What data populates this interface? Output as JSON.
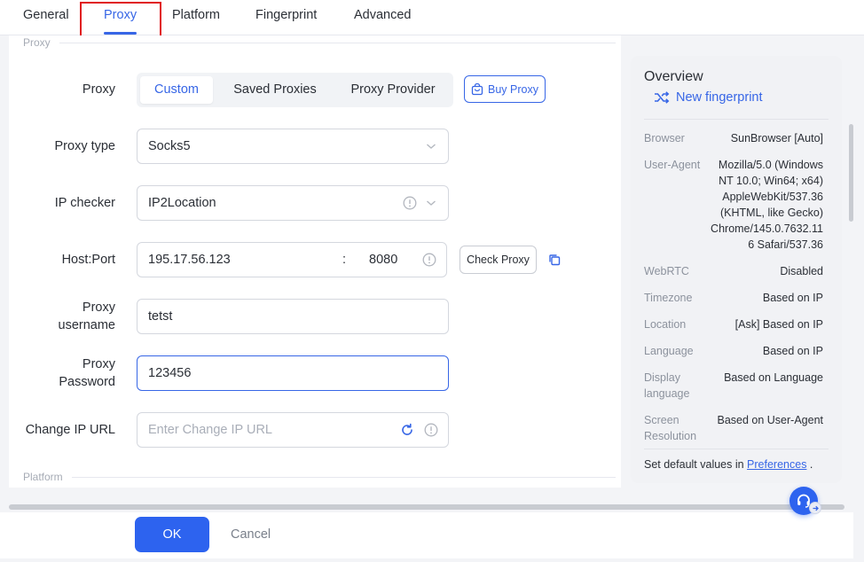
{
  "tabs": [
    {
      "label": "General"
    },
    {
      "label": "Proxy"
    },
    {
      "label": "Platform"
    },
    {
      "label": "Fingerprint"
    },
    {
      "label": "Advanced"
    }
  ],
  "active_tab": "Proxy",
  "sections": {
    "proxy": "Proxy",
    "platform": "Platform"
  },
  "form": {
    "proxy": {
      "label": "Proxy",
      "options": [
        "Custom",
        "Saved Proxies",
        "Proxy Provider"
      ],
      "selected": "Custom",
      "buy_label": "Buy Proxy"
    },
    "proxy_type": {
      "label": "Proxy type",
      "value": "Socks5"
    },
    "ip_checker": {
      "label": "IP checker",
      "value": "IP2Location"
    },
    "host_port": {
      "label": "Host:Port",
      "host": "195.17.56.123",
      "separator": ":",
      "port": "8080",
      "check_label": "Check Proxy"
    },
    "username": {
      "label_line1": "Proxy",
      "label_line2": "username",
      "value": "tetst"
    },
    "password": {
      "label_line1": "Proxy",
      "label_line2": "Password",
      "value": "123456"
    },
    "change_ip": {
      "label": "Change IP URL",
      "placeholder": "Enter Change IP URL"
    }
  },
  "overview": {
    "title": "Overview",
    "new_fingerprint": "New fingerprint",
    "rows": [
      {
        "key": "Browser",
        "value": "SunBrowser [Auto]"
      },
      {
        "key": "User-Agent",
        "value_lines": [
          "Mozilla/5.0 (Windows",
          "NT 10.0; Win64; x64)",
          "AppleWebKit/537.36",
          "(KHTML, like Gecko)",
          "Chrome/145.0.7632.11",
          "6 Safari/537.36"
        ]
      },
      {
        "key": "WebRTC",
        "value": "Disabled"
      },
      {
        "key": "Timezone",
        "value": "Based on IP"
      },
      {
        "key": "Location",
        "value": "[Ask] Based on IP"
      },
      {
        "key": "Language",
        "value": "Based on IP"
      },
      {
        "key_lines": [
          "Display",
          "language"
        ],
        "value": "Based on Language"
      },
      {
        "key_lines": [
          "Screen",
          "Resolution"
        ],
        "value": "Based on User-Agent"
      }
    ],
    "footer_prefix": "Set default values in ",
    "footer_link": "Preferences",
    "footer_suffix": " ."
  },
  "actions": {
    "ok": "OK",
    "cancel": "Cancel"
  },
  "colors": {
    "accent": "#3766e6",
    "primary_button": "#2d63ef",
    "highlight_box": "#e0161b"
  },
  "icons": [
    "shopping-bag-icon",
    "chevron-down-icon",
    "info-circle-icon",
    "copy-icon",
    "refresh-icon",
    "shuffle-icon",
    "headset-icon"
  ]
}
